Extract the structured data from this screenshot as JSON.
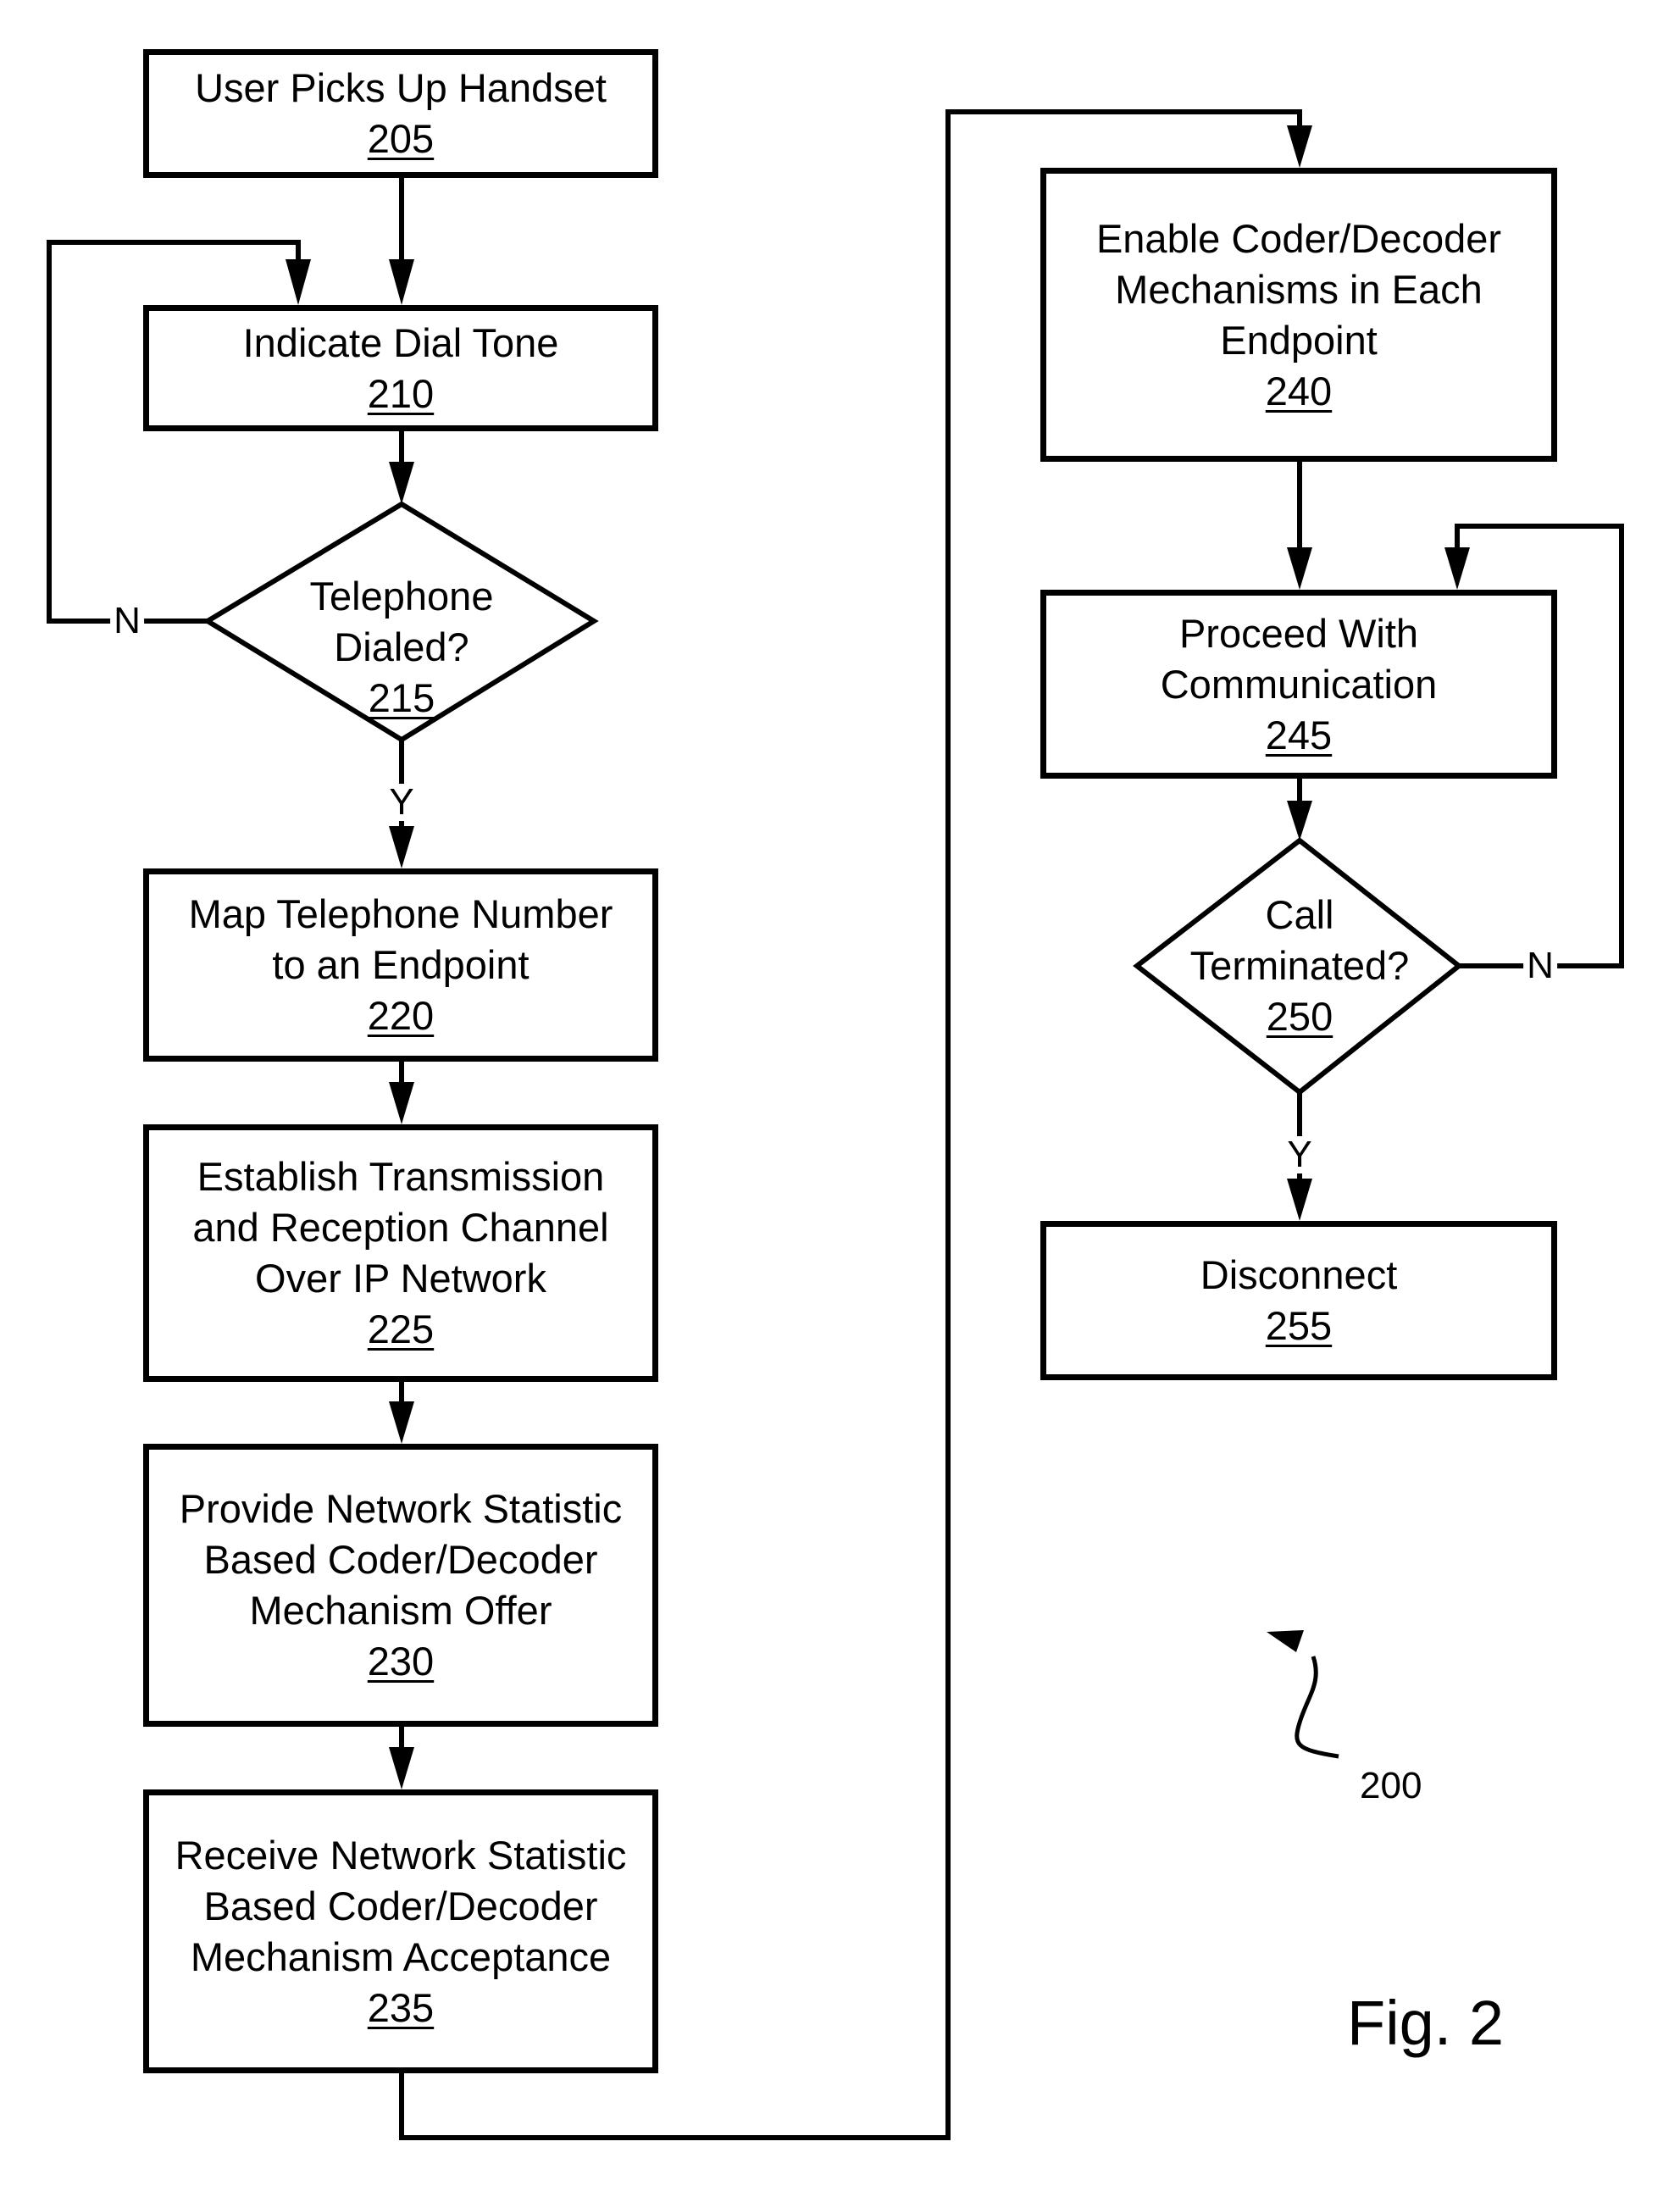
{
  "figure": {
    "title": "Fig. 2",
    "reference": "200"
  },
  "steps": [
    {
      "id": "205",
      "lines": [
        "User Picks Up Handset"
      ],
      "ref": "205"
    },
    {
      "id": "210",
      "lines": [
        "Indicate Dial Tone"
      ],
      "ref": "210"
    },
    {
      "id": "215",
      "lines": [
        "Telephone",
        "Dialed?"
      ],
      "ref": "215"
    },
    {
      "id": "220",
      "lines": [
        "Map Telephone Number",
        "to an Endpoint"
      ],
      "ref": "220"
    },
    {
      "id": "225",
      "lines": [
        "Establish Transmission",
        "and Reception Channel",
        "Over IP Network"
      ],
      "ref": "225"
    },
    {
      "id": "230",
      "lines": [
        "Provide Network Statistic",
        "Based Coder/Decoder",
        "Mechanism Offer"
      ],
      "ref": "230"
    },
    {
      "id": "235",
      "lines": [
        "Receive Network Statistic",
        "Based Coder/Decoder",
        "Mechanism Acceptance"
      ],
      "ref": "235"
    },
    {
      "id": "240",
      "lines": [
        "Enable Coder/Decoder",
        "Mechanisms in Each",
        "Endpoint"
      ],
      "ref": "240"
    },
    {
      "id": "245",
      "lines": [
        "Proceed With",
        "Communication"
      ],
      "ref": "245"
    },
    {
      "id": "250",
      "lines": [
        "Call",
        "Terminated?"
      ],
      "ref": "250"
    },
    {
      "id": "255",
      "lines": [
        "Disconnect"
      ],
      "ref": "255"
    }
  ],
  "branch_labels": {
    "d215_no": "N",
    "d215_yes": "Y",
    "d250_no": "N",
    "d250_yes": "Y"
  }
}
